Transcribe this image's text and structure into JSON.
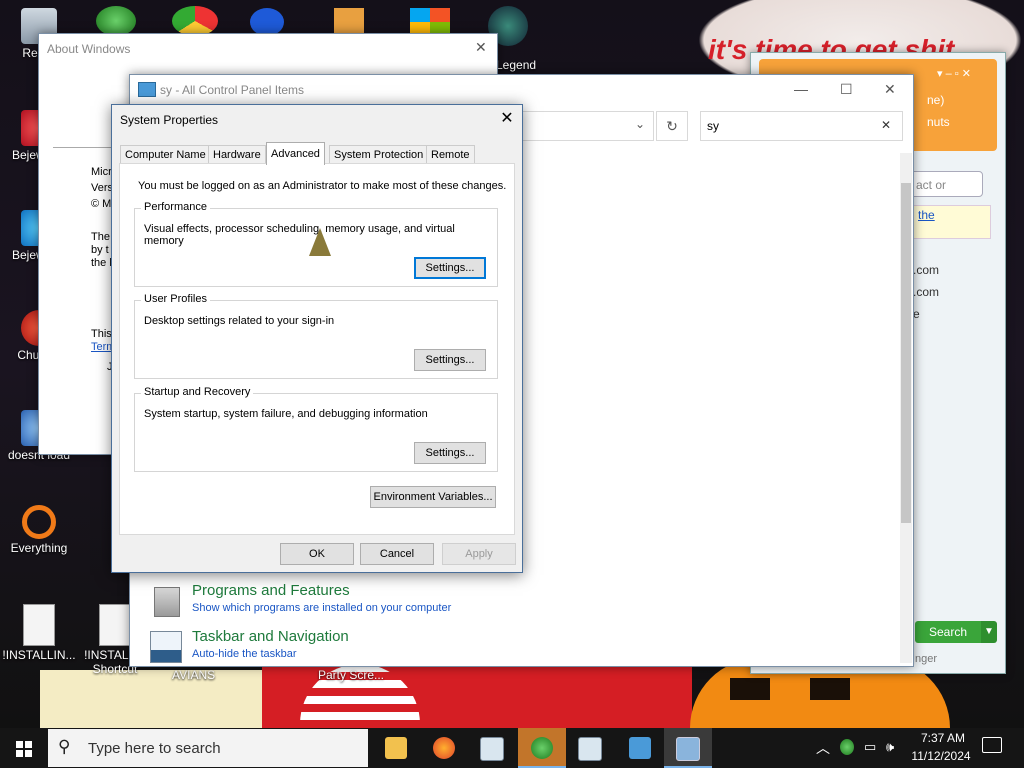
{
  "desktop": {
    "wallpaper_text": "it's time to get shit",
    "icons": [
      {
        "label": "Recyc",
        "shortcut": false
      },
      {
        "label": "Bejew Del",
        "shortcut": true
      },
      {
        "label": "Bejew Del",
        "shortcut": true
      },
      {
        "label": "Chu Del",
        "shortcut": true
      },
      {
        "label": "doesnt load",
        "shortcut": true
      },
      {
        "label": "Everything",
        "shortcut": true
      },
      {
        "label": "!INSTALLIN...",
        "shortcut": false
      },
      {
        "label": "!INSTALLI - Shortcut",
        "shortcut": true
      }
    ],
    "top_icons": [
      {
        "label": "Legend"
      }
    ],
    "partial_labels": {
      "avians": "AVIANS",
      "party": "Party Scre..."
    }
  },
  "about_window": {
    "title": "About Windows",
    "lines": [
      "Micr",
      "Vers",
      "© M"
    ],
    "body_lines": [
      "The",
      "by t",
      "the l"
    ],
    "footer_text": "This",
    "footer_link": "Term",
    "footer_tail": "J"
  },
  "messenger": {
    "search_placeholder": "act or numbe",
    "link_fragment": "the",
    "items": [
      ".com",
      ".com",
      "e"
    ],
    "header_lines": [
      "ne)",
      "nuts"
    ],
    "search_button": "Search",
    "footer_fragment": "nger"
  },
  "control_panel": {
    "title": "sy - All Control Panel Items",
    "search_value": "sy",
    "items": [
      {
        "title": "Programs and Features",
        "subtitle": "Show which programs are installed on your computer",
        "icon": "programs-icon"
      },
      {
        "title": "Taskbar and Navigation",
        "subtitle": "Auto-hide the taskbar",
        "icon": "taskbar-icon"
      }
    ]
  },
  "system_properties": {
    "title": "System Properties",
    "tabs": [
      "Computer Name",
      "Hardware",
      "Advanced",
      "System Protection",
      "Remote"
    ],
    "active_tab": "Advanced",
    "admin_note": "You must be logged on as an Administrator to make most of these changes.",
    "groups": [
      {
        "title": "Performance",
        "description": "Visual effects, processor scheduling, memory usage, and virtual memory",
        "button": "Settings..."
      },
      {
        "title": "User Profiles",
        "description": "Desktop settings related to your sign-in",
        "button": "Settings..."
      },
      {
        "title": "Startup and Recovery",
        "description": "System startup, system failure, and debugging information",
        "button": "Settings..."
      }
    ],
    "env_button": "Environment Variables...",
    "ok": "OK",
    "cancel": "Cancel",
    "apply": "Apply"
  },
  "taskbar": {
    "search_placeholder": "Type here to search",
    "time": "7:37 AM",
    "date": "11/12/2024",
    "colors": {
      "accent": "#0078d7",
      "taskbar": "#151515"
    }
  }
}
